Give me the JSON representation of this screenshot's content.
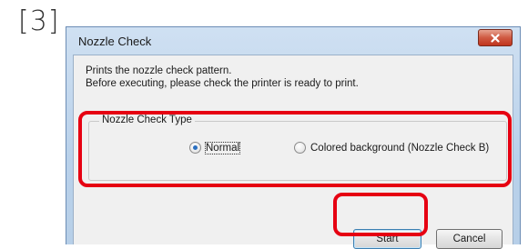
{
  "step_label": "[3]",
  "window": {
    "title": "Nozzle Check",
    "close_icon": "close-icon"
  },
  "message": {
    "line1": "Prints the nozzle check pattern.",
    "line2": "Before executing, please check the printer is ready to print."
  },
  "nozzle_check_type": {
    "legend": "Nozzle Check Type",
    "options": [
      {
        "label": "Normal",
        "selected": true
      },
      {
        "label": "Colored background (Nozzle Check B)",
        "selected": false
      }
    ]
  },
  "buttons": {
    "start": "Start",
    "cancel": "Cancel"
  },
  "colors": {
    "highlight": "#e60012",
    "titlebar": "#b9d1ea",
    "close_button": "#c0351f"
  }
}
